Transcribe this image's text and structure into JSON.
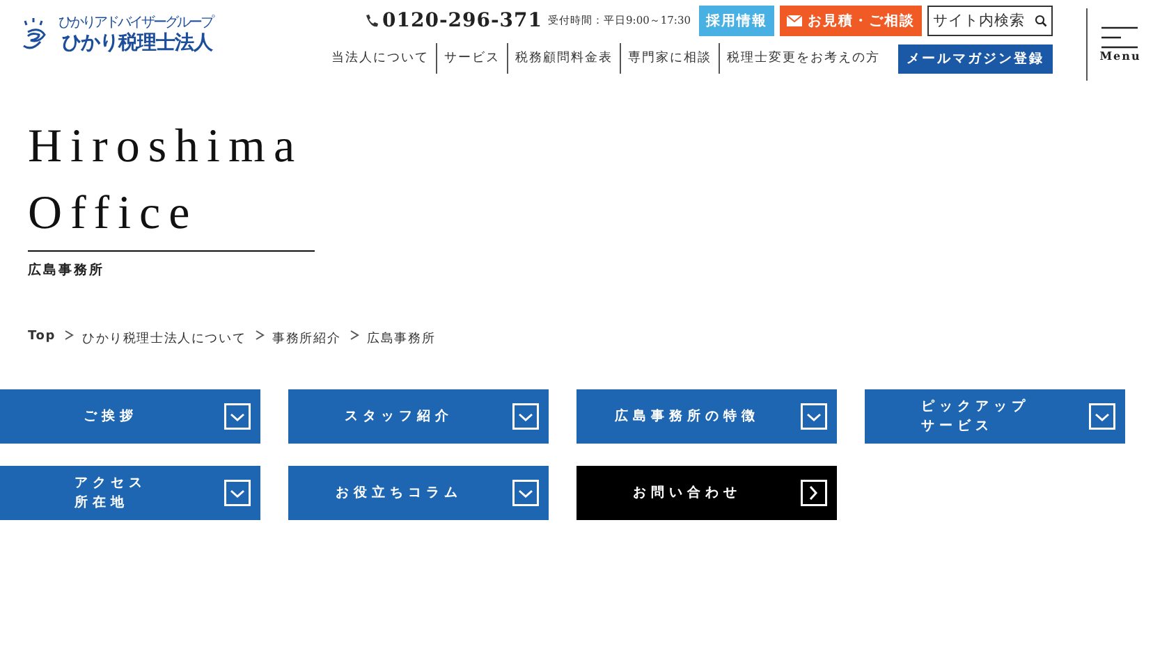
{
  "header": {
    "logo": {
      "tagline": "ひかりアドバイザーグループ",
      "name": "ひかり税理士法人"
    },
    "phone": "0120-296-371",
    "hours": "受付時間：平日9:00～17:30",
    "actions": [
      {
        "kind": "recruit",
        "label": "採用情報"
      },
      {
        "kind": "contact",
        "label": "お見積・ご相談"
      }
    ],
    "search": {
      "placeholder": "サイト内検索"
    },
    "nav": [
      "当法人について",
      "サービス",
      "税務顧問料金表",
      "専門家に相談",
      "税理士変更をお考えの方"
    ],
    "newsletter": "メールマガジン登録",
    "menu": "Menu"
  },
  "title": {
    "lines": [
      "Hiroshima",
      "Office"
    ],
    "subtitle": "広島事務所"
  },
  "breadcrumb": [
    "Top",
    "ひかり税理士法人について",
    "事務所紹介",
    "広島事務所"
  ],
  "sections": [
    {
      "kind": "anchor",
      "lines": [
        "ご挨拶"
      ]
    },
    {
      "kind": "anchor",
      "lines": [
        "スタッフ紹介"
      ]
    },
    {
      "kind": "anchor",
      "lines": [
        "広島事務所の特徴"
      ]
    },
    {
      "kind": "anchor",
      "lines": [
        "ピックアップ",
        "サービス"
      ]
    },
    {
      "kind": "anchor",
      "lines": [
        "アクセス",
        "所在地"
      ]
    },
    {
      "kind": "anchor",
      "lines": [
        "お役立ちコラム"
      ]
    },
    {
      "kind": "link",
      "lines": [
        "お問い合わせ"
      ]
    }
  ]
}
